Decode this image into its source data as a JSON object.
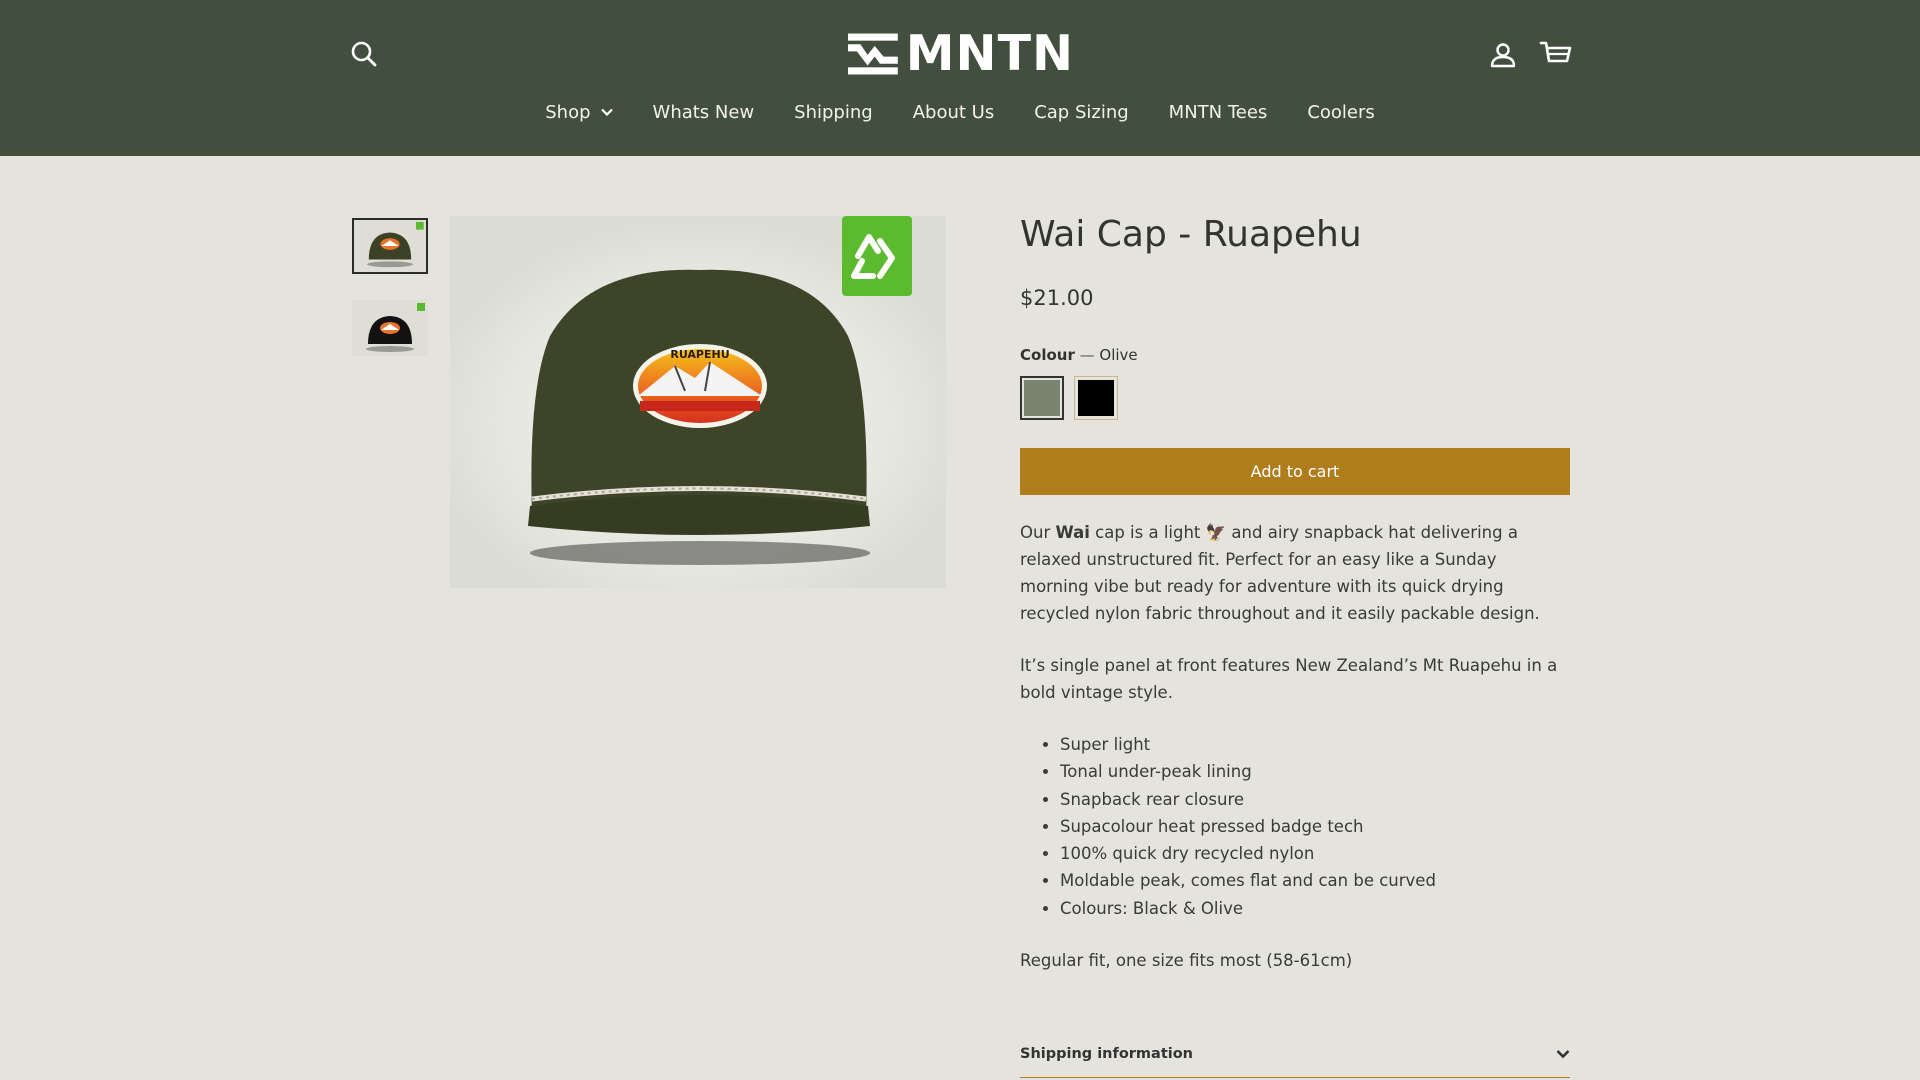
{
  "header": {
    "logo_text": "MNTN",
    "icons": {
      "search": "search-icon",
      "account": "user-icon",
      "cart": "cart-icon"
    },
    "nav": [
      {
        "label": "Shop",
        "has_dropdown": true
      },
      {
        "label": "Whats New"
      },
      {
        "label": "Shipping"
      },
      {
        "label": "About Us"
      },
      {
        "label": "Cap Sizing"
      },
      {
        "label": "MNTN Tees"
      },
      {
        "label": "Coolers"
      }
    ]
  },
  "product": {
    "title": "Wai Cap - Ruapehu",
    "price": "$21.00",
    "colour_label": "Colour",
    "colour_separator": "—",
    "colour_value": "Olive",
    "swatches": [
      {
        "name": "Olive",
        "color": "#7a8570",
        "selected": true
      },
      {
        "name": "Black",
        "color": "#000000",
        "selected": false
      }
    ],
    "add_to_cart": "Add to cart",
    "patch_text": "RUAPEHU",
    "description": {
      "p1_pre": "Our ",
      "p1_bold": "Wai",
      "p1_mid": " cap is a light ",
      "p1_emoji": "🦅",
      "p1_post": " and airy snapback hat delivering a relaxed unstructured fit. Perfect for an easy like a Sunday morning vibe but ready for adventure with its quick drying recycled nylon fabric throughout and it easily packable design.",
      "p2": "It’s single panel at front features New Zealand’s Mt Ruapehu in a bold vintage style.",
      "features": [
        "Super light",
        "Tonal under-peak lining",
        "Snapback rear closure",
        "Supacolour heat pressed badge tech",
        "100% quick dry recycled nylon",
        "Moldable peak, comes flat and can be curved",
        "Colours: Black & Olive"
      ],
      "fit": "Regular fit, one size fits most (58-61cm)"
    },
    "shipping_label": "Shipping information"
  },
  "colors": {
    "header_bg": "#434f3e",
    "page_bg": "#e4e4dd",
    "accent": "#b07d1d",
    "recycle_badge": "#5cba2f"
  }
}
